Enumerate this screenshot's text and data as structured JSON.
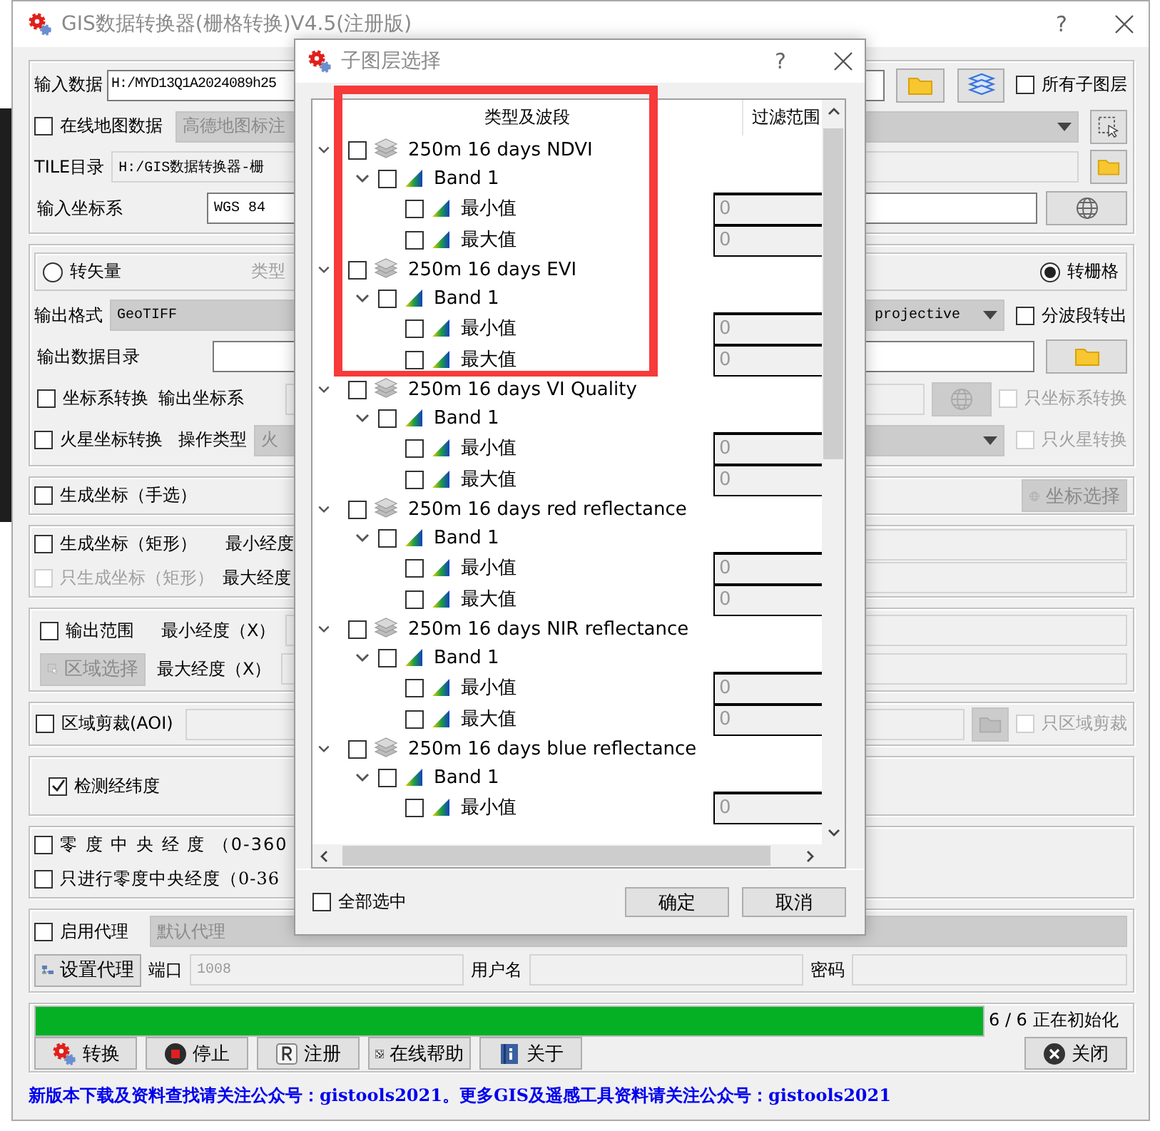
{
  "main_window": {
    "title": "GIS数据转换器(栅格转换)V4.5(注册版)",
    "help": "?"
  },
  "input": {
    "label": "输入数据",
    "value": "H:/MYD13Q1A2024089h25",
    "all_sublayers": {
      "label": "所有子图层",
      "checked": false
    }
  },
  "online_map": {
    "label": "在线地图数据",
    "checked": false,
    "source": "高德地图标注"
  },
  "tile_dir": {
    "label": "TILE目录",
    "value": "H:/GIS数据转换器-栅"
  },
  "input_crs": {
    "label": "输入坐标系",
    "value": "WGS 84"
  },
  "mode": [
    {
      "label": "转矢量",
      "selected": false
    },
    {
      "label": "转栅格",
      "selected": true
    }
  ],
  "type_label": "类型",
  "output_format": {
    "label": "输出格式",
    "value": "GeoTIFF",
    "resample": "projective",
    "split_bands": {
      "label": "分波段转出",
      "checked": false
    }
  },
  "output_dir": {
    "label": "输出数据目录"
  },
  "crs_convert": {
    "label": "坐标系转换",
    "checked": false,
    "output_crs_label": "输出坐标系",
    "only": {
      "label": "只坐标系转换",
      "checked": false,
      "disabled": true
    }
  },
  "mars_convert": {
    "label": "火星坐标转换",
    "checked": false,
    "op_label": "操作类型",
    "op_value": "火",
    "only": {
      "label": "只火星转换",
      "checked": false,
      "disabled": true
    }
  },
  "manual_coords": {
    "label": "生成坐标（手选）",
    "checked": false,
    "button": {
      "label": "坐标选择",
      "disabled": true
    }
  },
  "rect_coords": {
    "label": "生成坐标（矩形）",
    "checked": false,
    "only": {
      "label": "只生成坐标（矩形）",
      "checked": false,
      "disabled": true
    },
    "min_lon": "最小经度",
    "max_lon": "最大经度"
  },
  "output_extent": {
    "label": "输出范围",
    "checked": false,
    "button": {
      "label": "区域选择",
      "disabled": true
    },
    "min_x": "最小经度（X）",
    "max_x": "最大经度（X）"
  },
  "aoi": {
    "label": "区域剪裁(AOI)",
    "checked": false,
    "only": {
      "label": "只区域剪裁",
      "checked": false,
      "disabled": true
    }
  },
  "check_latlon": {
    "label": "检测经纬度",
    "checked": true
  },
  "zero_meridian": {
    "label": "零 度 中 央 经 度 （0-360",
    "checked": false
  },
  "zero_meridian_only": {
    "label": "只进行零度中央经度（0-36",
    "checked": false
  },
  "proxy": {
    "label": "启用代理",
    "checked": false,
    "preset": "默认代理",
    "set_button": "设置代理",
    "port_label": "端口",
    "port": "1008",
    "user_label": "用户名",
    "password_label": "密码"
  },
  "progress": {
    "level": 1,
    "text": "6 / 6 正在初始化"
  },
  "actions": [
    {
      "kind": "convert",
      "label": "转换"
    },
    {
      "kind": "stop",
      "label": "停止"
    },
    {
      "kind": "register",
      "label": "注册"
    },
    {
      "kind": "help",
      "label": "在线帮助"
    },
    {
      "kind": "about",
      "label": "关于"
    }
  ],
  "close_button": "关闭",
  "footer": "新版本下载及资料查找请关注公众号：gistools2021。更多GIS及遥感工具资料请关注公众号：gistools2021",
  "dialog": {
    "title": "子图层选择",
    "help": "?",
    "columns": [
      "类型及波段",
      "过滤范围"
    ],
    "layers": [
      {
        "name": "250m 16 days NDVI",
        "checked": false,
        "expanded": true,
        "children": [
          {
            "name": "Band 1",
            "checked": false,
            "expanded": true,
            "children": [
              {
                "name": "最小值",
                "checked": false,
                "filter": "0"
              },
              {
                "name": "最大值",
                "checked": false,
                "filter": "0"
              }
            ]
          }
        ]
      },
      {
        "name": "250m 16 days EVI",
        "checked": false,
        "expanded": true,
        "children": [
          {
            "name": "Band 1",
            "checked": false,
            "expanded": true,
            "children": [
              {
                "name": "最小值",
                "checked": false,
                "filter": "0"
              },
              {
                "name": "最大值",
                "checked": false,
                "filter": "0"
              }
            ]
          }
        ]
      },
      {
        "name": "250m 16 days VI Quality",
        "checked": false,
        "expanded": true,
        "children": [
          {
            "name": "Band 1",
            "checked": false,
            "expanded": true,
            "children": [
              {
                "name": "最小值",
                "checked": false,
                "filter": "0"
              },
              {
                "name": "最大值",
                "checked": false,
                "filter": "0"
              }
            ]
          }
        ]
      },
      {
        "name": "250m 16 days red reflectance",
        "checked": false,
        "expanded": true,
        "children": [
          {
            "name": "Band 1",
            "checked": false,
            "expanded": true,
            "children": [
              {
                "name": "最小值",
                "checked": false,
                "filter": "0"
              },
              {
                "name": "最大值",
                "checked": false,
                "filter": "0"
              }
            ]
          }
        ]
      },
      {
        "name": "250m 16 days NIR reflectance",
        "checked": false,
        "expanded": true,
        "children": [
          {
            "name": "Band 1",
            "checked": false,
            "expanded": true,
            "children": [
              {
                "name": "最小值",
                "checked": false,
                "filter": "0"
              },
              {
                "name": "最大值",
                "checked": false,
                "filter": "0"
              }
            ]
          }
        ]
      },
      {
        "name": "250m 16 days blue reflectance",
        "checked": false,
        "expanded": true,
        "children": [
          {
            "name": "Band 1",
            "checked": false,
            "expanded": true,
            "children": [
              {
                "name": "最小值",
                "checked": false,
                "filter": "0"
              }
            ]
          }
        ]
      }
    ],
    "select_all": {
      "label": "全部选中",
      "checked": false
    },
    "buttons": [
      "确定",
      "取消"
    ]
  }
}
